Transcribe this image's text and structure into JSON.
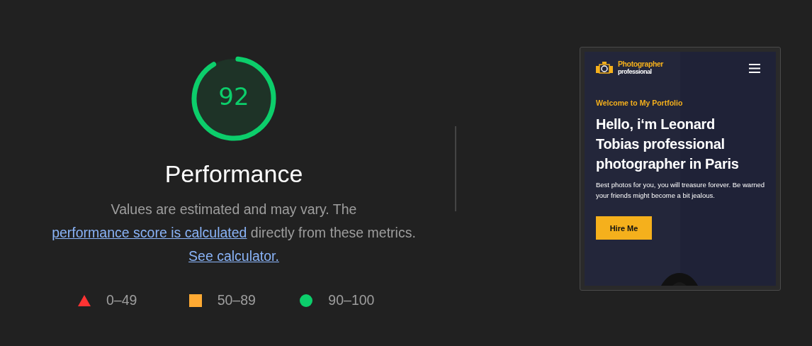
{
  "score": {
    "value": "92",
    "title": "Performance"
  },
  "description": [
    {
      "kind": "text",
      "text": "Values are estimated and may vary. The "
    },
    {
      "kind": "link",
      "text": "performance score is calculated"
    },
    {
      "kind": "text",
      "text": " directly from these metrics. "
    },
    {
      "kind": "link",
      "text": "See calculator."
    }
  ],
  "legend": [
    {
      "kind": "triangle",
      "color": "#ff3333",
      "label": "0–49"
    },
    {
      "kind": "square",
      "color": "#ffaa33",
      "label": "50–89"
    },
    {
      "kind": "circle",
      "color": "#0cce6b",
      "label": "90–100"
    }
  ],
  "preview": {
    "brand_top": "Photographer",
    "brand_bottom": "professional",
    "eyebrow": "Welcome to My Portfolio",
    "heading": "Hello, i‘m Leonard Tobias professional photographer in Paris",
    "body": "Best photos for you, you will treasure forever. Be warned your friends might become a bit jealous.",
    "button": "Hire Me"
  }
}
